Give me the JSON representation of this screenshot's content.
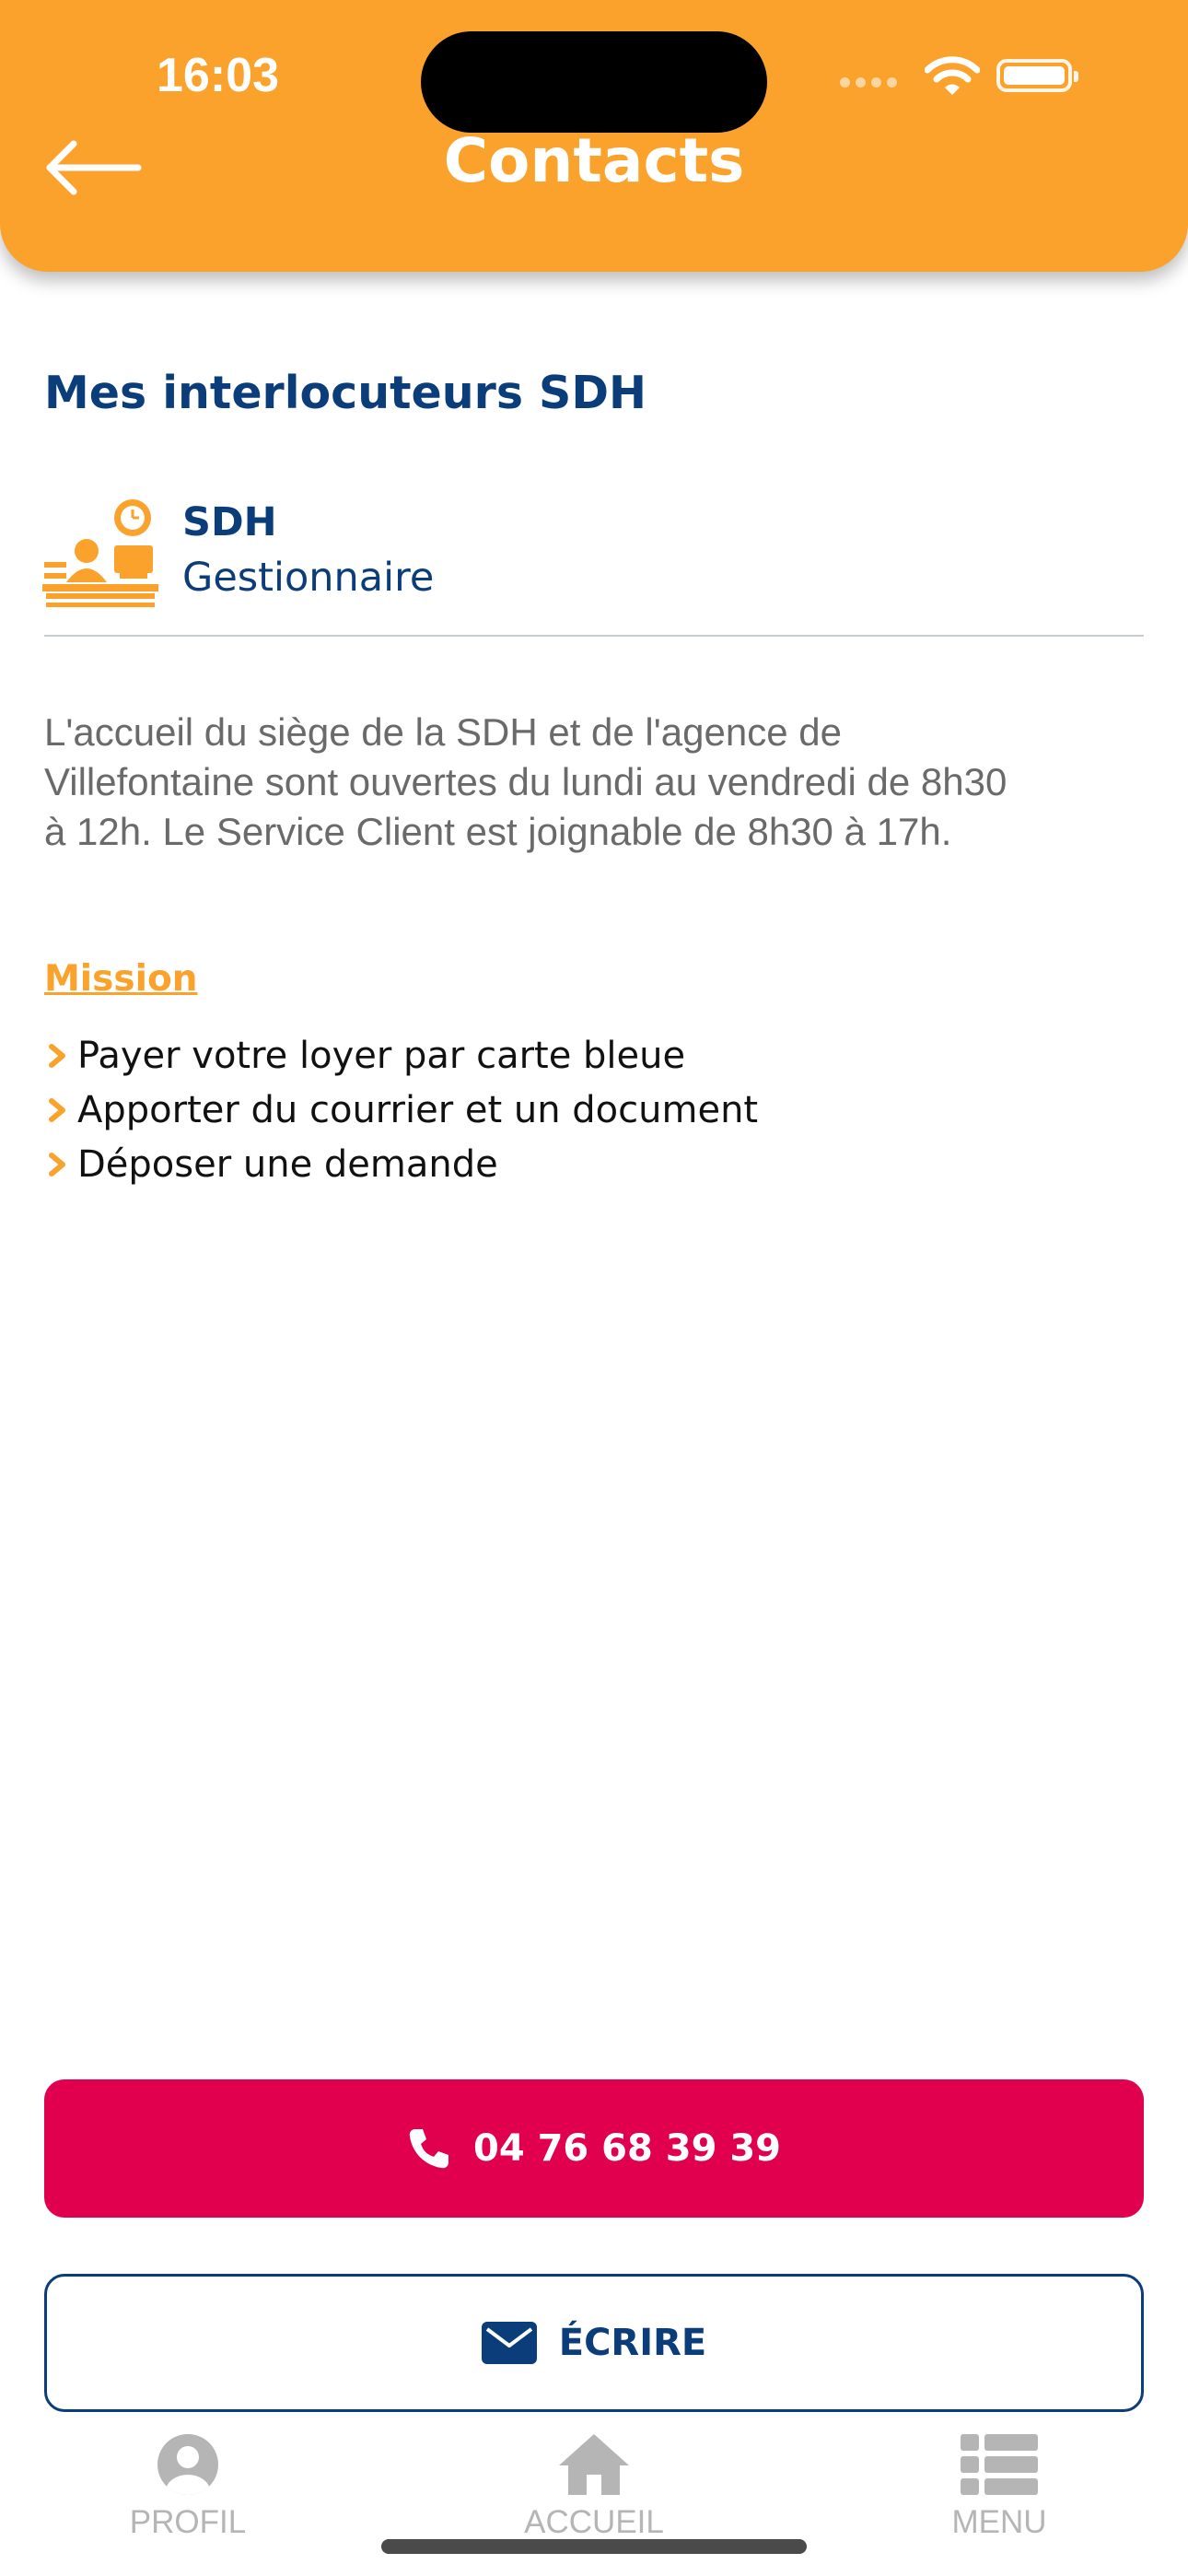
{
  "status_bar": {
    "time": "16:03"
  },
  "header": {
    "title": "Contacts",
    "back_icon": "arrow-left-icon"
  },
  "section": {
    "title": "Mes interlocuteurs SDH"
  },
  "contact": {
    "icon": "reception-desk-icon",
    "name": "SDH",
    "role": "Gestionnaire"
  },
  "info": {
    "lines": [
      "L'accueil du siège de la SDH et de l'agence de",
      "Villefontaine sont ouvertes du lundi au vendredi de 8h30",
      "à 12h. Le Service Client est joignable de 8h30 à 17h."
    ]
  },
  "mission": {
    "label": "Mission",
    "items": [
      "Payer votre loyer par carte bleue",
      "Apporter du courrier et un document",
      "Déposer une demande"
    ]
  },
  "actions": {
    "call": {
      "label": "04 76 68 39 39",
      "icon": "phone-icon"
    },
    "write": {
      "label": "ÉCRIRE",
      "icon": "envelope-icon"
    }
  },
  "bottom_nav": [
    {
      "label": "PROFIL",
      "icon": "user-circle-icon"
    },
    {
      "label": "ACCUEIL",
      "icon": "home-icon"
    },
    {
      "label": "MENU",
      "icon": "list-icon"
    }
  ],
  "colors": {
    "header": "#FAA22B",
    "primary_text": "#0B3D7A",
    "call_button": "#E0004D",
    "nav_inactive": "#b5b5b5"
  }
}
